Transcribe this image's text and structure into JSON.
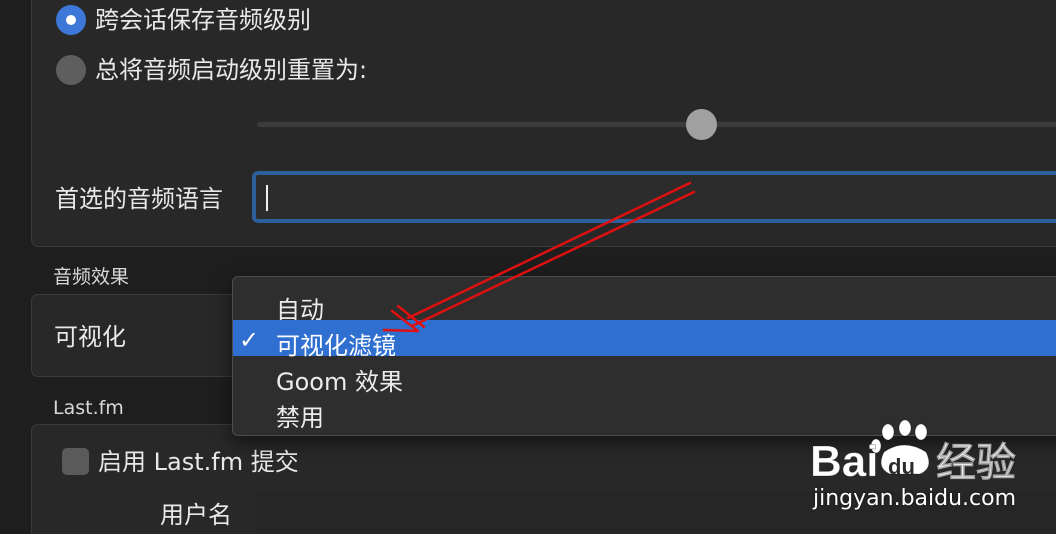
{
  "audio_level": {
    "option_persist_label": "跨会话保存音频级别",
    "option_reset_label": "总将音频启动级别重置为:",
    "selected_option": "persist"
  },
  "preferred_language": {
    "label": "首选的音频语言",
    "value": ""
  },
  "audio_effects": {
    "section_title": "音频效果",
    "visualization_label": "可视化",
    "menu_options": [
      "自动",
      "可视化滤镜",
      "Goom 效果",
      "禁用"
    ],
    "selected_option": "可视化滤镜",
    "check_glyph": "✓"
  },
  "lastfm": {
    "section_title": "Last.fm",
    "enable_label": "启用 Last.fm 提交",
    "enabled": false,
    "username_label": "用户名",
    "username_value": ""
  },
  "watermark": {
    "brand": "Baidu 经验",
    "url": "jingyan.baidu.com"
  },
  "colors": {
    "accent": "#2f6fd0",
    "annotation_arrow": "#e01010"
  }
}
